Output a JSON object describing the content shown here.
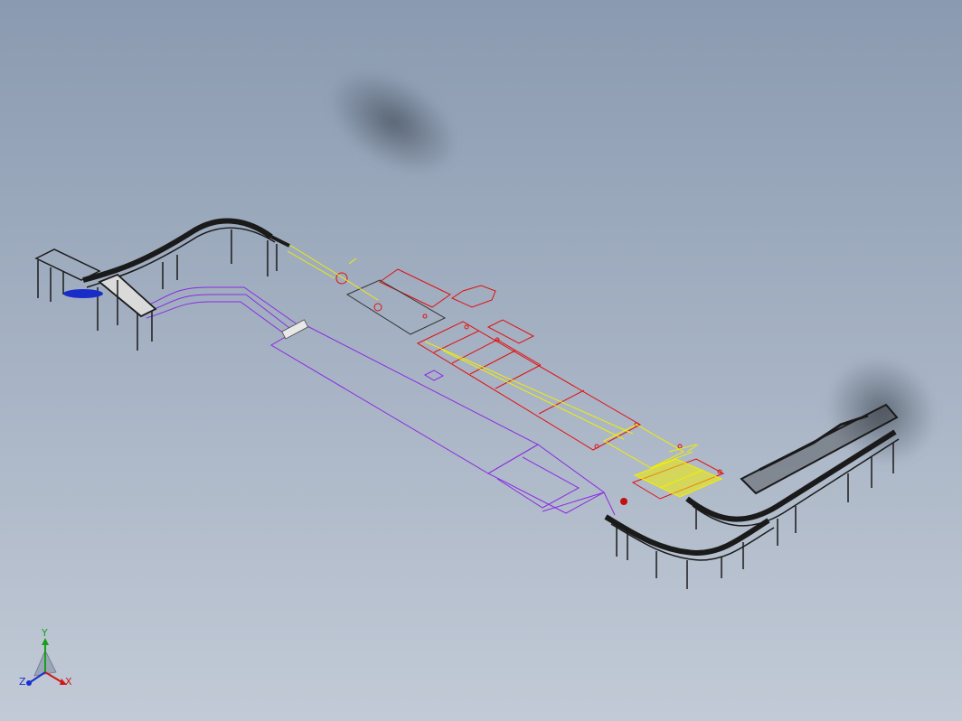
{
  "viewport": {
    "background_top": "#8a9ab0",
    "background_bottom": "#c2cad6"
  },
  "model_colors": {
    "conveyor": "#1a1a1a",
    "planning_red": "#e01010",
    "planning_yellow": "#f2ee00",
    "layout_purple": "#8a2be2",
    "accent_blue": "#1a2cc8"
  },
  "triad": {
    "x_label": "X",
    "y_label": "Y",
    "z_label": "Z",
    "x_color": "#d01818",
    "y_color": "#18a018",
    "z_color": "#1830d0"
  }
}
